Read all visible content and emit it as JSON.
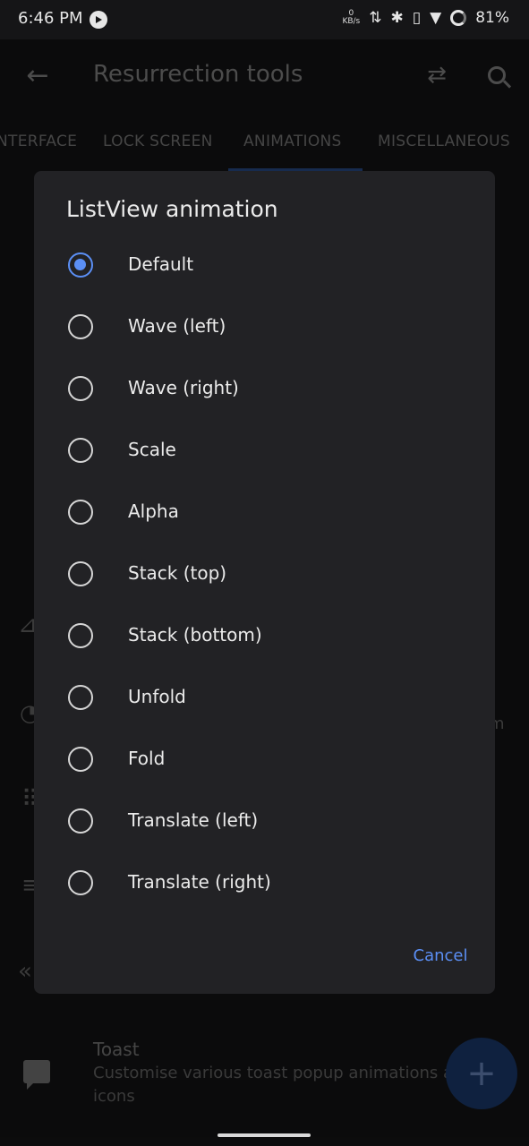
{
  "status_bar": {
    "time": "6:46 PM",
    "speed_value": "0",
    "speed_unit": "KB/s",
    "battery": "81%"
  },
  "app_bar": {
    "title": "Resurrection tools",
    "icons": [
      "back-arrow-icon",
      "swap-icon",
      "search-icon"
    ]
  },
  "tabs": [
    {
      "label": "NTERFACE"
    },
    {
      "label": "LOCK SCREEN"
    },
    {
      "label": "ANIMATIONS",
      "selected": true
    },
    {
      "label": "MISCELLANEOUS"
    }
  ],
  "background": {
    "fragment_text": "m",
    "toast_title": "Toast",
    "toast_desc": "Customise various toast popup animations a icons"
  },
  "dialog": {
    "title": "ListView animation",
    "options": [
      {
        "label": "Default",
        "selected": true
      },
      {
        "label": "Wave (left)",
        "selected": false
      },
      {
        "label": "Wave (right)",
        "selected": false
      },
      {
        "label": "Scale",
        "selected": false
      },
      {
        "label": "Alpha",
        "selected": false
      },
      {
        "label": "Stack (top)",
        "selected": false
      },
      {
        "label": "Stack (bottom)",
        "selected": false
      },
      {
        "label": "Unfold",
        "selected": false
      },
      {
        "label": "Fold",
        "selected": false
      },
      {
        "label": "Translate (left)",
        "selected": false
      },
      {
        "label": "Translate (right)",
        "selected": false
      }
    ],
    "cancel_label": "Cancel"
  },
  "colors": {
    "accent": "#5b8ff5",
    "dialog_bg": "#222225",
    "fab": "#1d3d73"
  }
}
